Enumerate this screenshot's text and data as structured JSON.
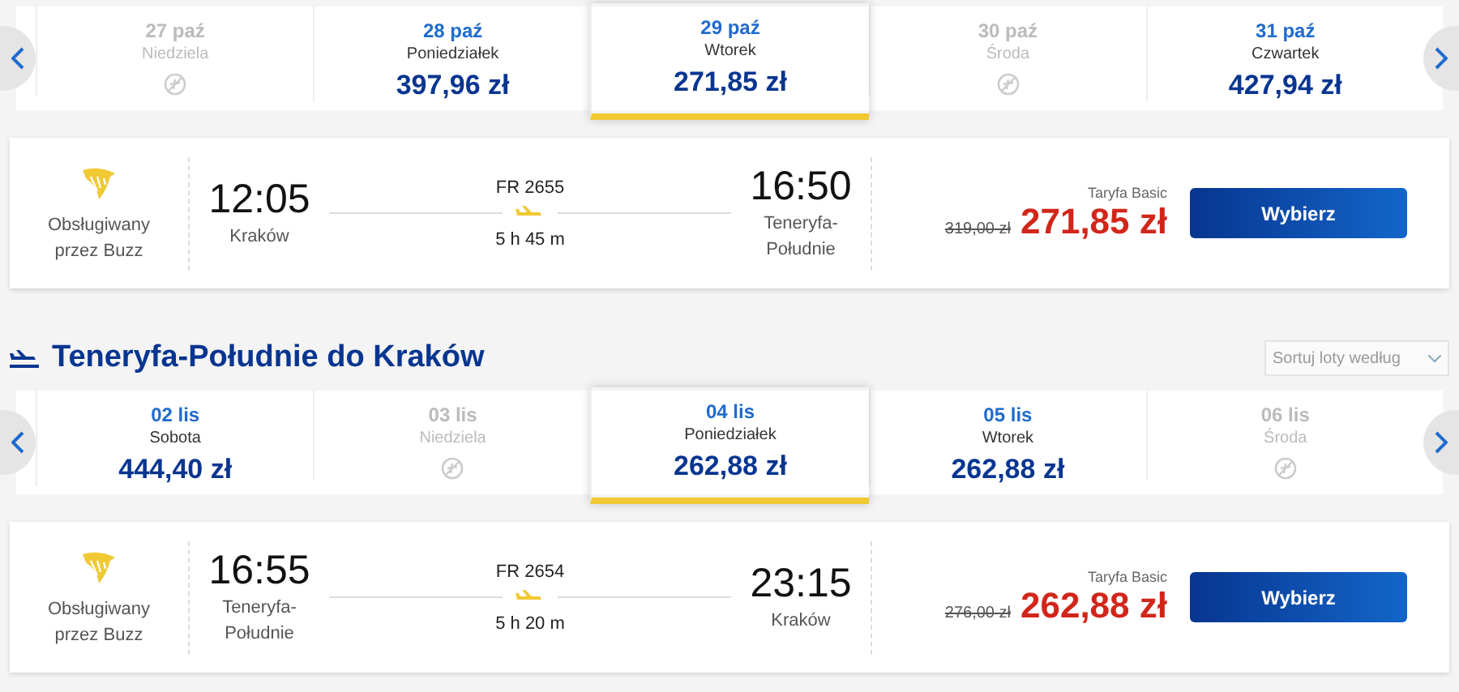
{
  "outbound": {
    "dates": [
      {
        "date": "27 paź",
        "day": "Niedziela",
        "available": false,
        "selected": false
      },
      {
        "date": "28 paź",
        "day": "Poniedziałek",
        "price": "397,96 zł",
        "available": true,
        "selected": false
      },
      {
        "date": "29 paź",
        "day": "Wtorek",
        "price": "271,85 zł",
        "available": true,
        "selected": true
      },
      {
        "date": "30 paź",
        "day": "Środa",
        "available": false,
        "selected": false
      },
      {
        "date": "31 paź",
        "day": "Czwartek",
        "price": "427,94 zł",
        "available": true,
        "selected": false
      }
    ],
    "flight": {
      "operator": "Obsługiwany przez Buzz",
      "depart_time": "12:05",
      "depart_city": "Kraków",
      "number": "FR 2655",
      "duration": "5 h 45 m",
      "arrive_time": "16:50",
      "arrive_city": "Teneryfa-Południe",
      "fare": "Taryfa Basic",
      "old_price": "319,00 zł",
      "price": "271,85 zł",
      "button": "Wybierz"
    }
  },
  "return_heading": "Teneryfa-Południe do Kraków",
  "sort": {
    "placeholder": "Sortuj loty według"
  },
  "return": {
    "dates": [
      {
        "date": "02 lis",
        "day": "Sobota",
        "price": "444,40 zł",
        "available": true,
        "selected": false
      },
      {
        "date": "03 lis",
        "day": "Niedziela",
        "available": false,
        "selected": false
      },
      {
        "date": "04 lis",
        "day": "Poniedziałek",
        "price": "262,88 zł",
        "available": true,
        "selected": true
      },
      {
        "date": "05 lis",
        "day": "Wtorek",
        "price": "262,88 zł",
        "available": true,
        "selected": false
      },
      {
        "date": "06 lis",
        "day": "Środa",
        "available": false,
        "selected": false
      }
    ],
    "flight": {
      "operator": "Obsługiwany przez Buzz",
      "depart_time": "16:55",
      "depart_city": "Teneryfa-Południe",
      "number": "FR 2654",
      "duration": "5 h 20 m",
      "arrive_time": "23:15",
      "arrive_city": "Kraków",
      "fare": "Taryfa Basic",
      "old_price": "276,00 zł",
      "price": "262,88 zł",
      "button": "Wybierz"
    }
  }
}
